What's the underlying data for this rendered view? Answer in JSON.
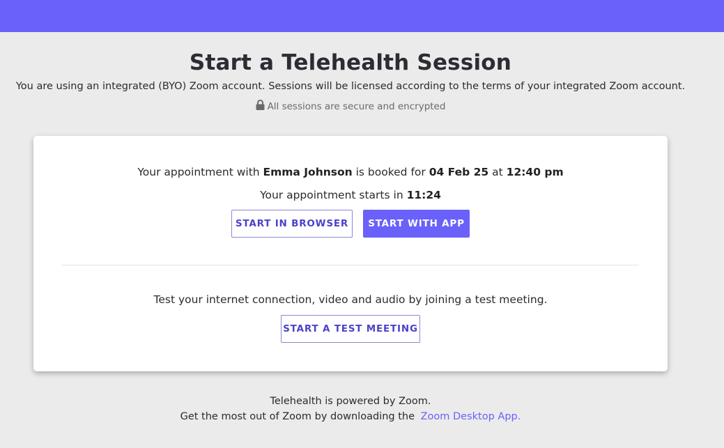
{
  "header": {
    "bar_color": "#6a61fb"
  },
  "page": {
    "title": "Start a Telehealth Session",
    "byo_notice": "You are using an integrated (BYO) Zoom account. Sessions will be licensed according to the terms of your integrated Zoom account.",
    "secure_text": "All sessions are secure and encrypted",
    "secure_icon": "lock-icon"
  },
  "appointment": {
    "prefix": "Your appointment with",
    "patient_name": "Emma Johnson",
    "booked_for": "is booked for",
    "date": "04 Feb 25",
    "at": "at",
    "time": "12:40 pm",
    "starts_prefix": "Your appointment starts in",
    "countdown": "11:24"
  },
  "buttons": {
    "start_in_browser": "START IN BROWSER",
    "start_with_app": "START WITH APP",
    "start_test_meeting": "START A TEST MEETING"
  },
  "test": {
    "text": "Test your internet connection, video and audio by joining a test meeting."
  },
  "footer": {
    "powered_by": "Telehealth is powered by Zoom.",
    "download_prefix": "Get the most out of Zoom by downloading the",
    "download_link": "Zoom Desktop App."
  },
  "colors": {
    "accent": "#6a61fb",
    "background": "#ebebeb",
    "card": "#ffffff"
  }
}
